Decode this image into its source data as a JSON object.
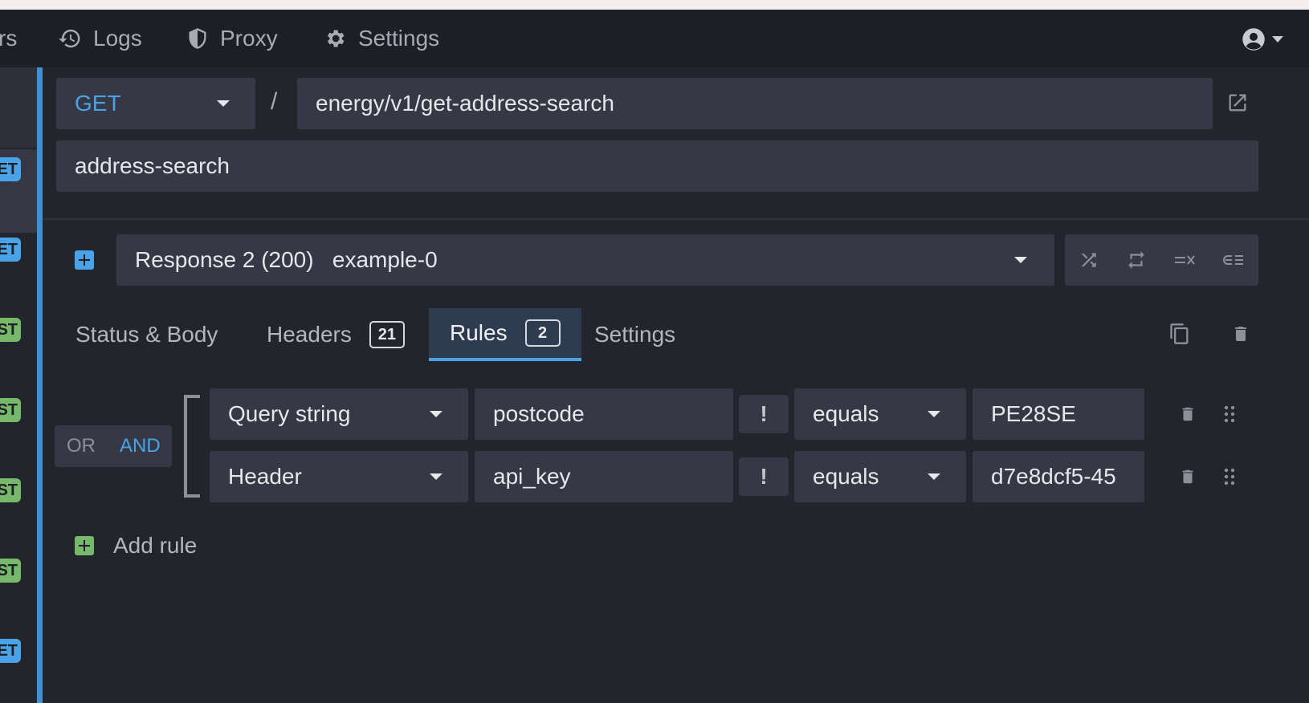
{
  "nav": {
    "partial_left": "rs",
    "logs_label": "Logs",
    "proxy_label": "Proxy",
    "settings_label": "Settings"
  },
  "sidebar": {
    "badges": [
      {
        "label": "ET",
        "color": "blue"
      },
      {
        "label": "ET",
        "color": "blue"
      },
      {
        "label": "ST",
        "color": "green"
      },
      {
        "label": "ST",
        "color": "green"
      },
      {
        "label": "ST",
        "color": "green"
      },
      {
        "label": "ST",
        "color": "green"
      },
      {
        "label": "ET",
        "color": "blue"
      }
    ]
  },
  "route": {
    "method": "GET",
    "separator": "/",
    "path": "energy/v1/get-address-search",
    "name": "address-search"
  },
  "response": {
    "selected": "Response 2 (200)   example-0"
  },
  "tabs": [
    {
      "label": "Status & Body",
      "count": null,
      "active": false
    },
    {
      "label": "Headers",
      "count": "21",
      "active": false
    },
    {
      "label": "Rules",
      "count": "2",
      "active": true
    },
    {
      "label": "Settings",
      "count": null,
      "active": false
    }
  ],
  "rules_operator": {
    "or_label": "OR",
    "and_label": "AND",
    "active": "AND"
  },
  "rules": [
    {
      "target": "Query string",
      "property": "postcode",
      "negate": "!",
      "operator": "equals",
      "value": "PE28SE"
    },
    {
      "target": "Header",
      "property": "api_key",
      "negate": "!",
      "operator": "equals",
      "value": "d7e8dcf5-45"
    }
  ],
  "add_rule_label": "Add rule",
  "colors": {
    "accent_blue": "#4aa3e6",
    "accent_green": "#77b86b",
    "background": "#23252c",
    "field": "#363945"
  }
}
